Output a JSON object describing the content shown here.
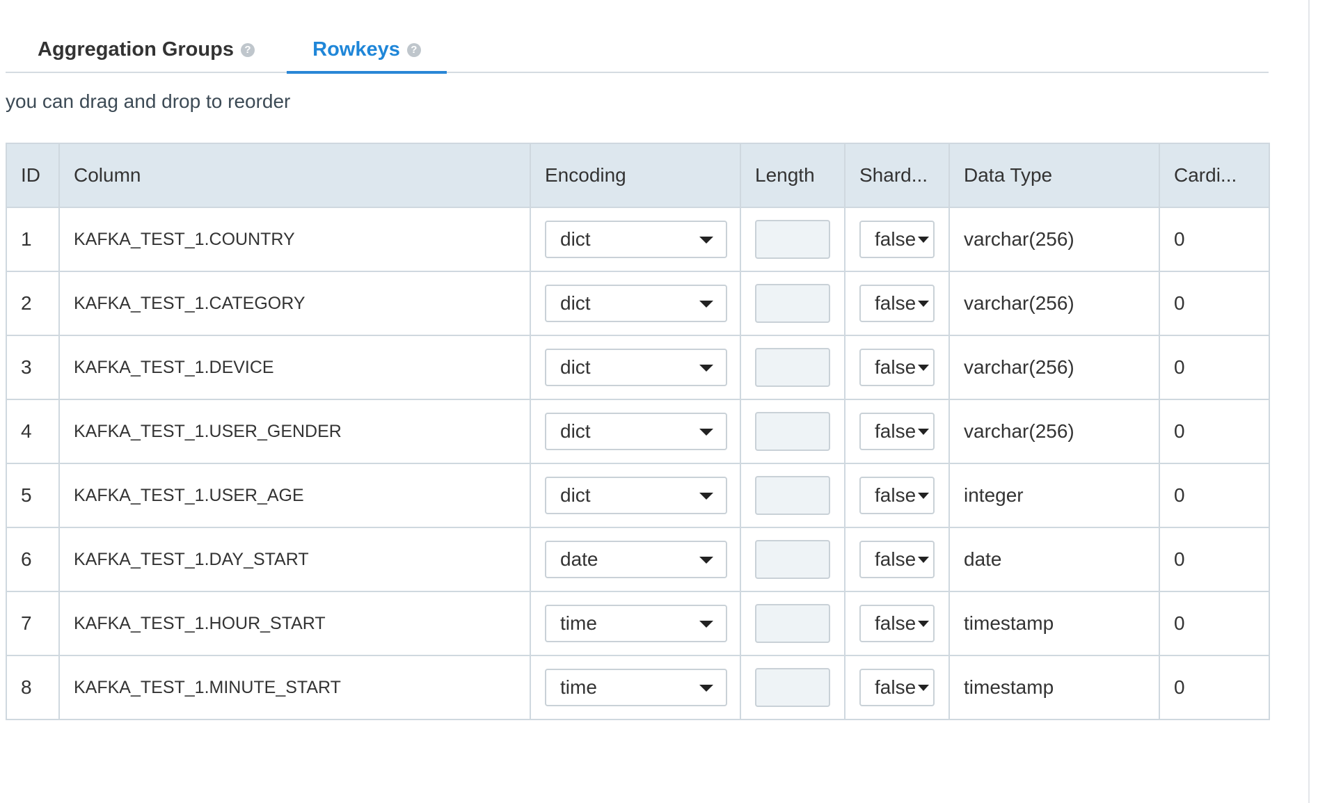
{
  "tabs": [
    {
      "label": "Aggregation Groups",
      "active": false
    },
    {
      "label": "Rowkeys",
      "active": true
    }
  ],
  "hint": "you can drag and drop to reorder",
  "table": {
    "headers": [
      "ID",
      "Column",
      "Encoding",
      "Length",
      "Shard...",
      "Data Type",
      "Cardi..."
    ],
    "rows": [
      {
        "id": "1",
        "column": "KAFKA_TEST_1.COUNTRY",
        "encoding": "dict",
        "length": "",
        "shard": "false",
        "data_type": "varchar(256)",
        "cardinality": "0"
      },
      {
        "id": "2",
        "column": "KAFKA_TEST_1.CATEGORY",
        "encoding": "dict",
        "length": "",
        "shard": "false",
        "data_type": "varchar(256)",
        "cardinality": "0"
      },
      {
        "id": "3",
        "column": "KAFKA_TEST_1.DEVICE",
        "encoding": "dict",
        "length": "",
        "shard": "false",
        "data_type": "varchar(256)",
        "cardinality": "0"
      },
      {
        "id": "4",
        "column": "KAFKA_TEST_1.USER_GENDER",
        "encoding": "dict",
        "length": "",
        "shard": "false",
        "data_type": "varchar(256)",
        "cardinality": "0"
      },
      {
        "id": "5",
        "column": "KAFKA_TEST_1.USER_AGE",
        "encoding": "dict",
        "length": "",
        "shard": "false",
        "data_type": "integer",
        "cardinality": "0"
      },
      {
        "id": "6",
        "column": "KAFKA_TEST_1.DAY_START",
        "encoding": "date",
        "length": "",
        "shard": "false",
        "data_type": "date",
        "cardinality": "0"
      },
      {
        "id": "7",
        "column": "KAFKA_TEST_1.HOUR_START",
        "encoding": "time",
        "length": "",
        "shard": "false",
        "data_type": "timestamp",
        "cardinality": "0"
      },
      {
        "id": "8",
        "column": "KAFKA_TEST_1.MINUTE_START",
        "encoding": "time",
        "length": "",
        "shard": "false",
        "data_type": "timestamp",
        "cardinality": "0"
      }
    ]
  },
  "icons": {
    "help": "question-circle-icon",
    "caret": "caret-down-icon"
  },
  "colors": {
    "accent": "#1f86d8",
    "header_bg": "#dde7ee",
    "border": "#cfd8df"
  }
}
